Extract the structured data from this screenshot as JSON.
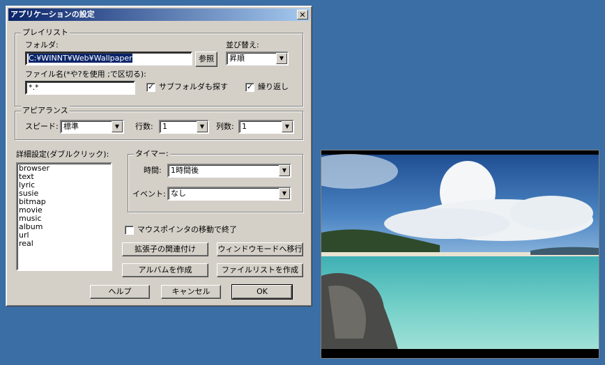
{
  "dialog": {
    "title": "アプリケーションの設定",
    "close": "✕"
  },
  "playlist": {
    "group_label": "プレイリスト",
    "folder_label": "フォルダ:",
    "folder_value": "C:¥WINNT¥Web¥Wallpaper",
    "browse_button": "参照",
    "sort_label": "並び替え:",
    "sort_value": "昇順",
    "filename_label": "ファイル名(*や?を使用 ;で区切る):",
    "filename_value": "*.*",
    "subfolder_label": "サブフォルダも探す",
    "subfolder_checked": true,
    "repeat_label": "繰り返し",
    "repeat_checked": true
  },
  "appearance": {
    "group_label": "アピアランス",
    "speed_label": "スピード:",
    "speed_value": "標準",
    "rows_label": "行数:",
    "rows_value": "1",
    "cols_label": "列数:",
    "cols_value": "1"
  },
  "details": {
    "label": "詳細設定(ダブルクリック):",
    "items": [
      "browser",
      "text",
      "lyric",
      "susie",
      "bitmap",
      "movie",
      "music",
      "album",
      "url",
      "real"
    ]
  },
  "timer": {
    "group_label": "タイマー:",
    "time_label": "時間:",
    "time_value": "1時間後",
    "event_label": "イベント:",
    "event_value": "なし"
  },
  "mouse_exit": {
    "label": "マウスポインタの移動で終了",
    "checked": false
  },
  "actions": {
    "associate": "拡張子の関連付け",
    "window_mode": "ウィンドウモードへ移行",
    "create_album": "アルバムを作成",
    "create_filelist": "ファイルリストを作成"
  },
  "footer": {
    "help": "ヘルプ",
    "cancel": "キャンセル",
    "ok": "OK"
  },
  "colors": {
    "desktop": "#3a6ea5",
    "title_start": "#0a246a",
    "title_end": "#a6caf0",
    "face": "#d4d0c8"
  }
}
